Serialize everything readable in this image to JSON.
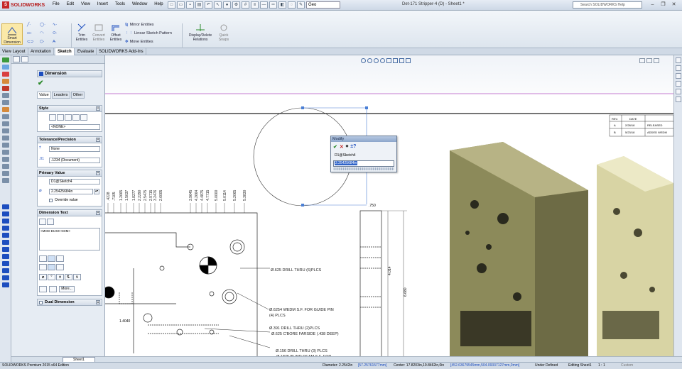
{
  "app": {
    "brand": "SOLIDWORKS",
    "doc_title": "Det-171 Stripper-4 (D) - Sheet1 *"
  },
  "menu": [
    "File",
    "Edit",
    "View",
    "Insert",
    "Tools",
    "Window",
    "Help"
  ],
  "qat": {
    "layer_value": "Geo"
  },
  "help_search": {
    "placeholder": "Search SOLIDWORKS Help"
  },
  "ribbon": {
    "smart_dimension": "Smart Dimension",
    "trim_entities": "Trim Entities",
    "convert_entities": "Convert Entities",
    "offset_entities": "Offset Entities",
    "mirror_entities": "Mirror Entities",
    "linear_sketch_pattern": "Linear Sketch Pattern",
    "move_entities": "Move Entities",
    "display_delete_relations": "Display/Delete Relations",
    "quick_snaps": "Quick Snaps"
  },
  "tabs": [
    "View Layout",
    "Annotation",
    "Sketch",
    "Evaluate",
    "SOLIDWORKS Add-Ins"
  ],
  "active_tab": "Sketch",
  "pm": {
    "title": "Dimension",
    "subtabs": [
      "Value",
      "Leaders",
      "Other"
    ],
    "style": {
      "header": "Style",
      "select": "<NONE>"
    },
    "tolerance": {
      "header": "Tolerance/Precision",
      "type": "None",
      "precision": ".1234 (Document)"
    },
    "primary": {
      "header": "Primary Value",
      "name": "D1@Sketch4",
      "value": "2.25425684in",
      "override_label": "Override value"
    },
    "dimtext": {
      "header": "Dimension Text",
      "text": "<MOD-DIAM><DIM>",
      "more": "More..."
    },
    "dual": {
      "header": "Dual Dimension"
    }
  },
  "modify": {
    "title": "Modify",
    "name": "D1@Sketch4",
    "value": "2.25425684in"
  },
  "drawing": {
    "table_headers": [
      "REV.",
      "DATE"
    ],
    "table_rows": [
      {
        "rev": "A",
        "date": "2/28/18",
        "desc": "RELEASED"
      },
      {
        "rev": "B",
        "date": "5/23/18",
        "desc": "ADDED WEDM"
      }
    ],
    "ordinates_left": [
      ".4228",
      ".7105",
      "1.2665",
      "1.5037",
      "1.8277",
      "2.2290",
      "2.5475",
      "2.9715",
      "3.2476",
      "2.6005"
    ],
    "ordinates_right": [
      "3.9645",
      "4.2664",
      "4.4875",
      "4.7715",
      "5.0000",
      "5.0114",
      "5.2065",
      "5.3830"
    ],
    "dim_small": ".750",
    "dim_v1": "4.014",
    "dim_v2": "6.680",
    "dim_x": "1.4040",
    "notes": [
      "Ø.625 DRILL THRU (6)PLCS",
      "Ø.6254 WEDM S.F. FOR GUIDE PIN",
      "(4) PLCS",
      "Ø.391 DRILL THRU (2)PLCS",
      "Ø.625 C'BORE FARSIDE (.438 DEEP)",
      "Ø.156 DRILL THRU (3) PLCS",
      "Ø.1875 BLIND REAM S.F. FOR"
    ]
  },
  "sheet_tab": "Sheet1",
  "status": {
    "edition": "SOLIDWORKS Premium 2015 x64 Edition",
    "diameter_label": "Diameter: 2.2542in",
    "diameter_mm": "[57.25761577mm]",
    "center_label": "Center: 17.8203in,19.8462in,0in",
    "center_mm": "[452.63679545mm,504.09337127mm,0mm]",
    "state": "Under Defined",
    "editing": "Editing Sheet1",
    "scale": "1 : 1",
    "custom": "Custom"
  },
  "colors": {
    "accent": "#1d4ebf",
    "sketch_blue": "#4a7fd6",
    "part_tan": "#8c8a5a"
  }
}
